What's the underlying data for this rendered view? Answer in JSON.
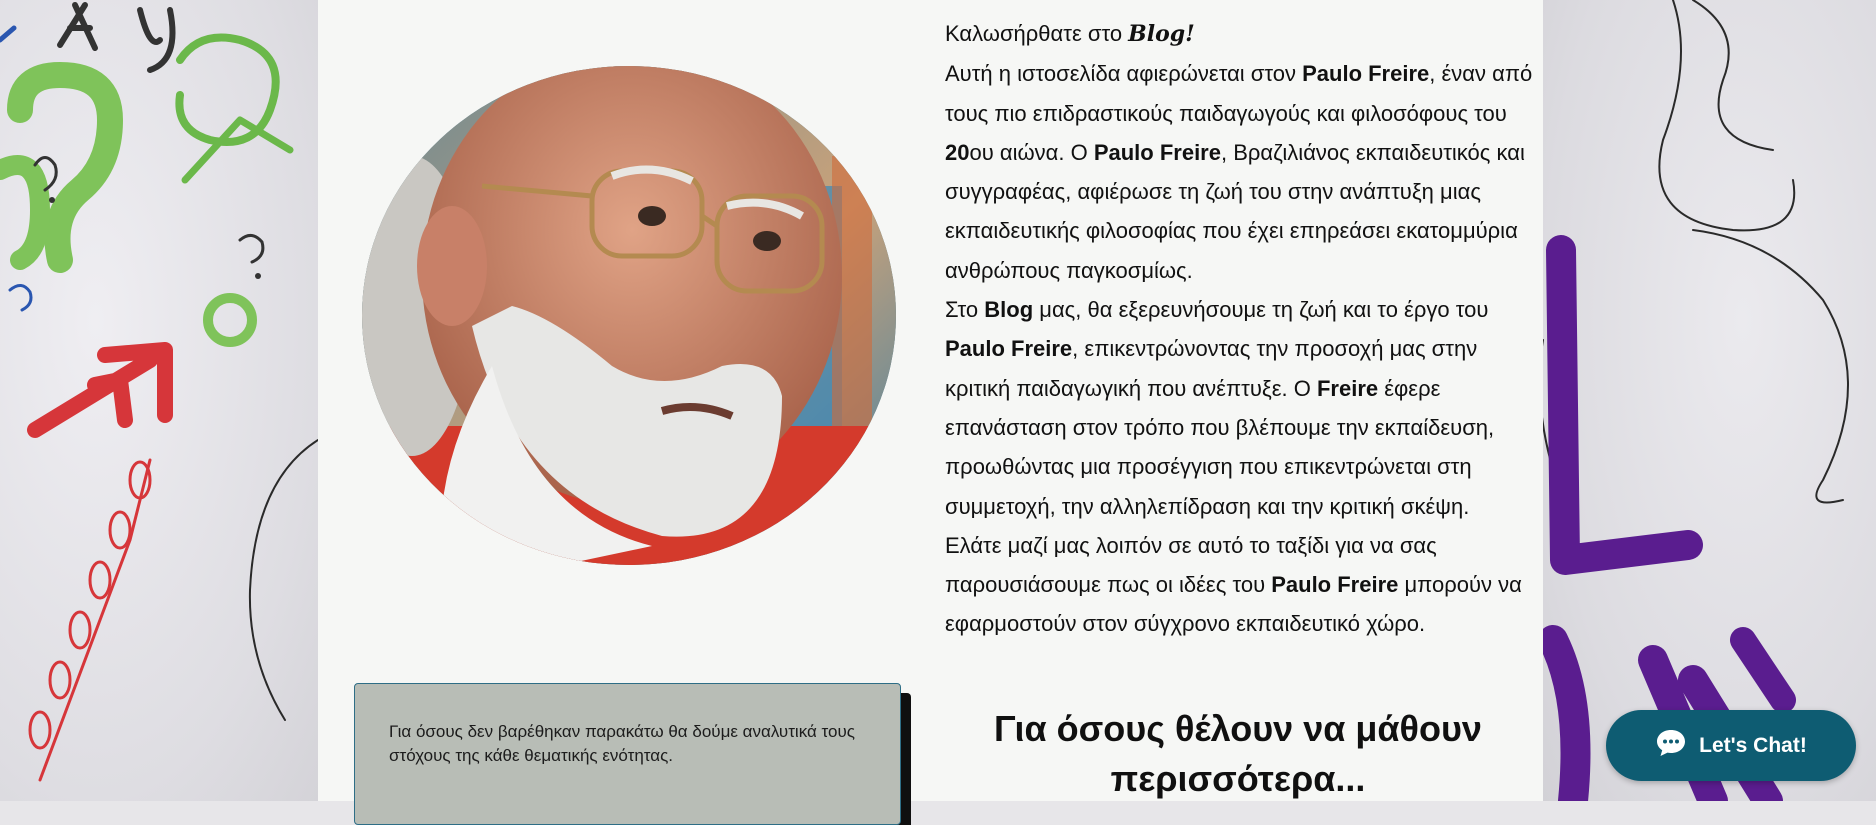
{
  "welcome": {
    "prefix": "Καλωσήρθατε στο ",
    "blog_word": "Blog!"
  },
  "intro_paragraph": {
    "part1": "Αυτή η ιστοσελίδα αφιερώνεται στον ",
    "name1": "Paulo Freire",
    "part2": ", έναν από τους πιο επιδραστικούς παιδαγωγούς και φιλοσόφους του ",
    "century": "20",
    "part3": "ου αιώνα. Ο ",
    "name2": "Paulo Freire",
    "part4": ", Βραζιλιάνος εκπαιδευτικός και συγγραφέας, αφιέρωσε τη ζωή του στην ανάπτυξη μιας εκπαιδευτικής φιλοσοφίας που έχει επηρεάσει εκατομμύρια ανθρώπους παγκοσμίως."
  },
  "blog_paragraph": {
    "part1": "Στο ",
    "blog": "Blog",
    "part2": " μας, θα εξερευνήσουμε τη ζωή και το έργο του ",
    "name1": "Paulo Freire",
    "part3": ", επικεντρώνοντας την προσοχή μας στην κριτική παιδαγωγική που ανέπτυξε. Ο ",
    "name2": "Freire",
    "part4": " έφερε επανάσταση στον τρόπο που βλέπουμε την εκπαίδευση, προωθώντας μια προσέγγιση που επικεντρώνεται στη συμμετοχή, την αλληλεπίδραση και την κριτική σκέψη."
  },
  "journey_paragraph": {
    "part1": "Ελάτε μαζί μας λοιπόν σε αυτό το ταξίδι για να σας παρουσιάσουμε πως οι ιδέες του ",
    "name": "Paulo Freire",
    "part2": " μπορούν να εφαρμοστούν στον σύγχρονο εκπαιδευτικό χώρο."
  },
  "callout": {
    "text": "Για όσους δεν βαρέθηκαν παρακάτω θα δούμε αναλυτικά τους στόχους της κάθε θεματικής ενότητας."
  },
  "more_heading": "Για όσους θέλουν να μάθουν περισσότερα...",
  "chat": {
    "label": "Let's Chat!",
    "icon": "chat-bubble-icon"
  },
  "colors": {
    "accent": "#0e5c72",
    "page_bg": "#f6f7f5",
    "callout_bg": "#b8bdb6"
  }
}
